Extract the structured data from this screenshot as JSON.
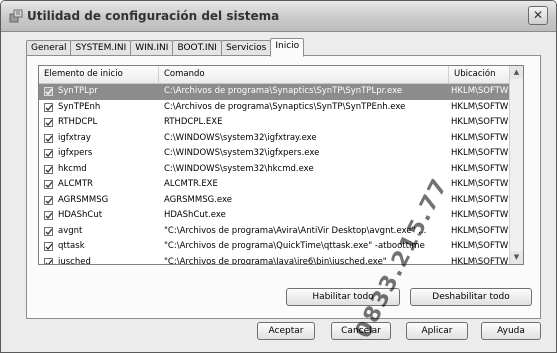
{
  "window": {
    "title": "Utilidad de configuración del sistema",
    "close_glyph": "✕"
  },
  "tabs": [
    "General",
    "SYSTEM.INI",
    "WIN.INI",
    "BOOT.INI",
    "Servicios",
    "Inicio"
  ],
  "active_tab": "Inicio",
  "list": {
    "columns": [
      "Elemento de inicio",
      "Comando",
      "Ubicación"
    ],
    "rows": [
      {
        "name": "SynTPLpr",
        "command": "C:\\Archivos de programa\\Synaptics\\SynTP\\SynTPLpr.exe",
        "location": "HKLM\\SOFTW",
        "checked": true,
        "selected": true
      },
      {
        "name": "SynTPEnh",
        "command": "C:\\Archivos de programa\\Synaptics\\SynTP\\SynTPEnh.exe",
        "location": "HKLM\\SOFTW",
        "checked": true,
        "selected": false
      },
      {
        "name": "RTHDCPL",
        "command": "RTHDCPL.EXE",
        "location": "HKLM\\SOFTW",
        "checked": true,
        "selected": false
      },
      {
        "name": "igfxtray",
        "command": "C:\\WINDOWS\\system32\\igfxtray.exe",
        "location": "HKLM\\SOFTW",
        "checked": true,
        "selected": false
      },
      {
        "name": "igfxpers",
        "command": "C:\\WINDOWS\\system32\\igfxpers.exe",
        "location": "HKLM\\SOFTW",
        "checked": true,
        "selected": false
      },
      {
        "name": "hkcmd",
        "command": "C:\\WINDOWS\\system32\\hkcmd.exe",
        "location": "HKLM\\SOFTW",
        "checked": true,
        "selected": false
      },
      {
        "name": "ALCMTR",
        "command": "ALCMTR.EXE",
        "location": "HKLM\\SOFTW",
        "checked": true,
        "selected": false
      },
      {
        "name": "AGRSMMSG",
        "command": "AGRSMMSG.exe",
        "location": "HKLM\\SOFTW",
        "checked": true,
        "selected": false
      },
      {
        "name": "HDAShCut",
        "command": "HDAShCut.exe",
        "location": "HKLM\\SOFTW",
        "checked": true,
        "selected": false
      },
      {
        "name": "avgnt",
        "command": "\"C:\\Archivos de programa\\Avira\\AntiVir Desktop\\avgnt.exe\" ...",
        "location": "HKLM\\SOFTW",
        "checked": true,
        "selected": false
      },
      {
        "name": "qttask",
        "command": "\"C:\\Archivos de programa\\QuickTime\\qttask.exe\" -atboottime",
        "location": "HKLM\\SOFTW",
        "checked": true,
        "selected": false
      },
      {
        "name": "jusched",
        "command": "\"C:\\Archivos de programa\\Java\\jre6\\bin\\jusched.exe\"",
        "location": "HKLM\\SOFTW",
        "checked": true,
        "selected": false
      }
    ]
  },
  "buttons": {
    "enable_all": "Habilitar todo",
    "disable_all": "Deshabilitar todo",
    "ok": "Aceptar",
    "cancel": "Cancelar",
    "apply": "Aplicar",
    "help": "Ayuda"
  },
  "watermark": "0833.215.77",
  "colors": {
    "selection": "#8c8c8c",
    "window_bg": "#ececec"
  }
}
